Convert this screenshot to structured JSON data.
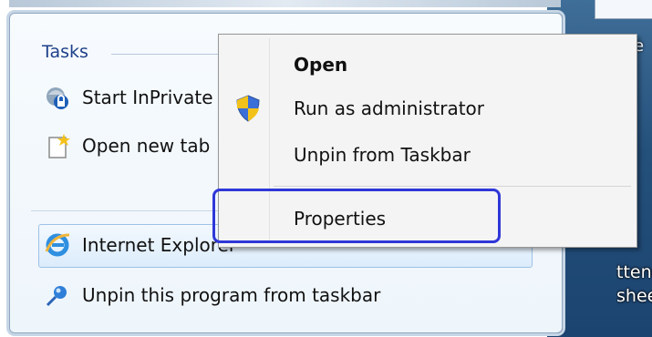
{
  "jump_list": {
    "tasks_header": "Tasks",
    "tasks": [
      {
        "label": "Start InPrivate Browsing",
        "icon": "inprivate-icon"
      },
      {
        "label": "Open new tab",
        "icon": "new-tab-icon"
      }
    ],
    "pinned_program": {
      "label": "Internet Explorer",
      "icon": "internet-explorer-icon"
    },
    "unpin_action": {
      "label": "Unpin this program from taskbar",
      "icon": "unpin-pin-icon"
    }
  },
  "context_menu": {
    "items": [
      {
        "label": "Open",
        "bold": true
      },
      {
        "label": "Run as administrator",
        "icon": "uac-shield-icon"
      },
      {
        "label": "Unpin from Taskbar"
      },
      {
        "label": "Properties",
        "highlighted": true
      }
    ]
  },
  "desktop": {
    "icon_label_line1": "ttendan",
    "icon_label_line2": "sheet",
    "partial_text": "e"
  },
  "colors": {
    "highlight_border": "#2f37d8",
    "tasks_header": "#1e3f8a",
    "menu_background": "#f4f4f4"
  }
}
